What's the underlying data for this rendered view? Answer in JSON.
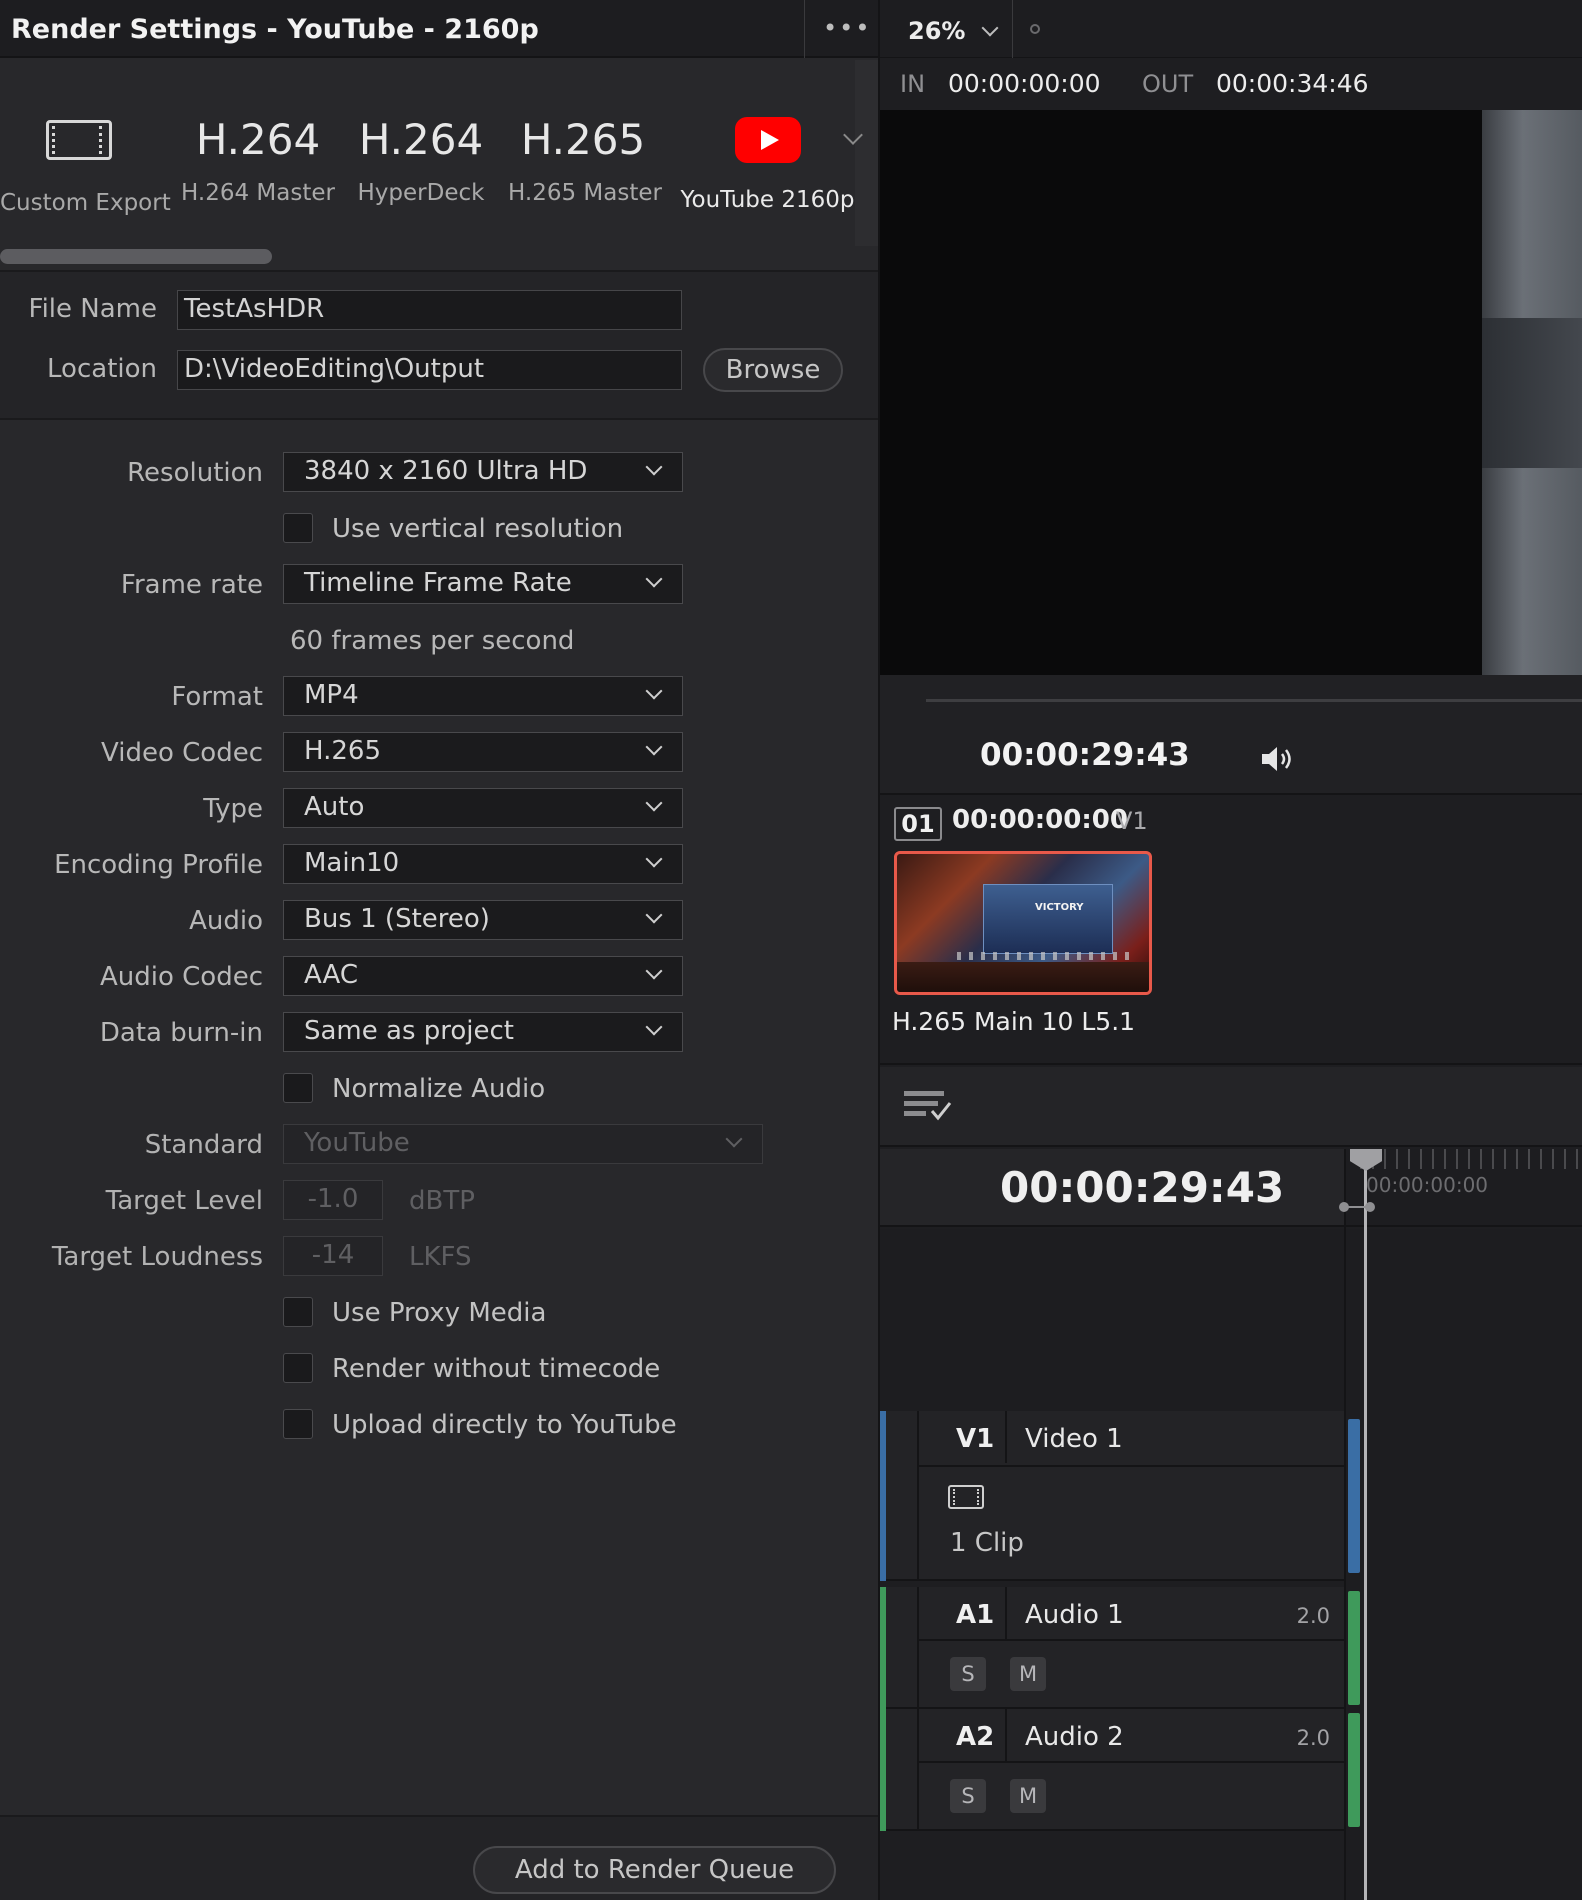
{
  "left_panel": {
    "title": "Render Settings - YouTube - 2160p",
    "more_icon": "ellipsis-icon",
    "presets": [
      {
        "big": "",
        "icon": "film-icon",
        "label": "Custom Export"
      },
      {
        "big": "H.264",
        "label": "H.264 Master"
      },
      {
        "big": "H.264",
        "label": "HyperDeck"
      },
      {
        "big": "H.265",
        "label": "H.265 Master"
      },
      {
        "big": "",
        "icon": "youtube-icon",
        "label": "YouTube 2160p"
      }
    ],
    "file_name_label": "File Name",
    "file_name_value": "TestAsHDR",
    "location_label": "Location",
    "location_value": "D:\\VideoEditing\\Output",
    "browse_label": "Browse",
    "settings": {
      "resolution_label": "Resolution",
      "resolution_value": "3840 x 2160 Ultra HD",
      "vertical_label": "Use vertical resolution",
      "framerate_label": "Frame rate",
      "framerate_value": "Timeline Frame Rate",
      "fps_text": "60 frames per second",
      "format_label": "Format",
      "format_value": "MP4",
      "codec_label": "Video Codec",
      "codec_value": "H.265",
      "type_label": "Type",
      "type_value": "Auto",
      "profile_label": "Encoding Profile",
      "profile_value": "Main10",
      "audio_label": "Audio",
      "audio_value": "Bus 1 (Stereo)",
      "audio_codec_label": "Audio Codec",
      "audio_codec_value": "AAC",
      "burnin_label": "Data burn-in",
      "burnin_value": "Same as project",
      "normalize_label": "Normalize Audio",
      "standard_label": "Standard",
      "standard_value": "YouTube",
      "target_level_label": "Target Level",
      "target_level_value": "-1.0",
      "target_level_unit": "dBTP",
      "target_loudness_label": "Target Loudness",
      "target_loudness_value": "-14",
      "target_loudness_unit": "LKFS",
      "proxy_label": "Use Proxy Media",
      "no_timecode_label": "Render without timecode",
      "upload_label": "Upload directly to YouTube"
    },
    "add_queue_label": "Add to Render Queue"
  },
  "viewer": {
    "zoom": "26%",
    "in_label": "IN",
    "in_tc": "00:00:00:00",
    "out_label": "OUT",
    "out_tc": "00:00:34:46",
    "current_tc": "00:00:29:43",
    "speaker_icon": "speaker-icon"
  },
  "clip": {
    "number": "01",
    "timecode": "00:00:00:00",
    "track": "V1",
    "thumb_text": "VICTORY",
    "codec": "H.265 Main 10 L5.1"
  },
  "timeline": {
    "queue_icon": "list-check-icon",
    "current_tc": "00:00:29:43",
    "ruler_tc": "00:00:00:00",
    "tracks": [
      {
        "id": "V1",
        "name": "Video 1",
        "clips": "1 Clip",
        "color": "#3a6ea5"
      },
      {
        "id": "A1",
        "name": "Audio 1",
        "channels": "2.0",
        "solo": "S",
        "mute": "M",
        "color": "#3f9a5b"
      },
      {
        "id": "A2",
        "name": "Audio 2",
        "channels": "2.0",
        "solo": "S",
        "mute": "M",
        "color": "#3f9a5b"
      }
    ]
  }
}
